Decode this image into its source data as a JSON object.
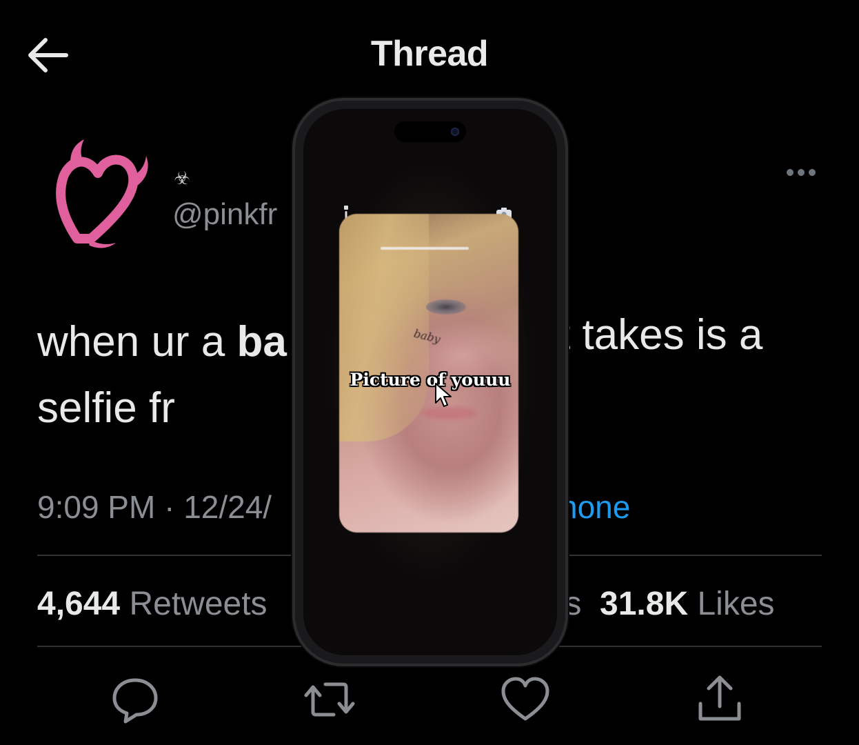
{
  "header": {
    "title": "Thread",
    "back_icon": "arrow-left-icon"
  },
  "tweet": {
    "bio_icon": "☣",
    "handle": "@pinkfr",
    "text_left_pre": "when ur a ",
    "text_left_bold": "ba",
    "text_left_line2": "selfie fr",
    "text_right": "t takes is a",
    "time": "9:09 PM · 12/24/",
    "source": "hone",
    "retweets_count": "4,644",
    "retweets_label": "Retweets",
    "quotes_partial": "ts",
    "likes_count": "31.8K",
    "likes_label": "Likes"
  },
  "overlay": {
    "caption": "Picture of youuu"
  },
  "colors": {
    "background": "#000000",
    "link": "#1d9bf0",
    "avatar": "#e0609e",
    "muted": "#8b8f94"
  },
  "icons": [
    "arrow-left-icon",
    "more-icon",
    "reply-icon",
    "retweet-icon",
    "like-icon",
    "share-icon",
    "flash-icon",
    "camera-icon",
    "cursor-icon"
  ]
}
